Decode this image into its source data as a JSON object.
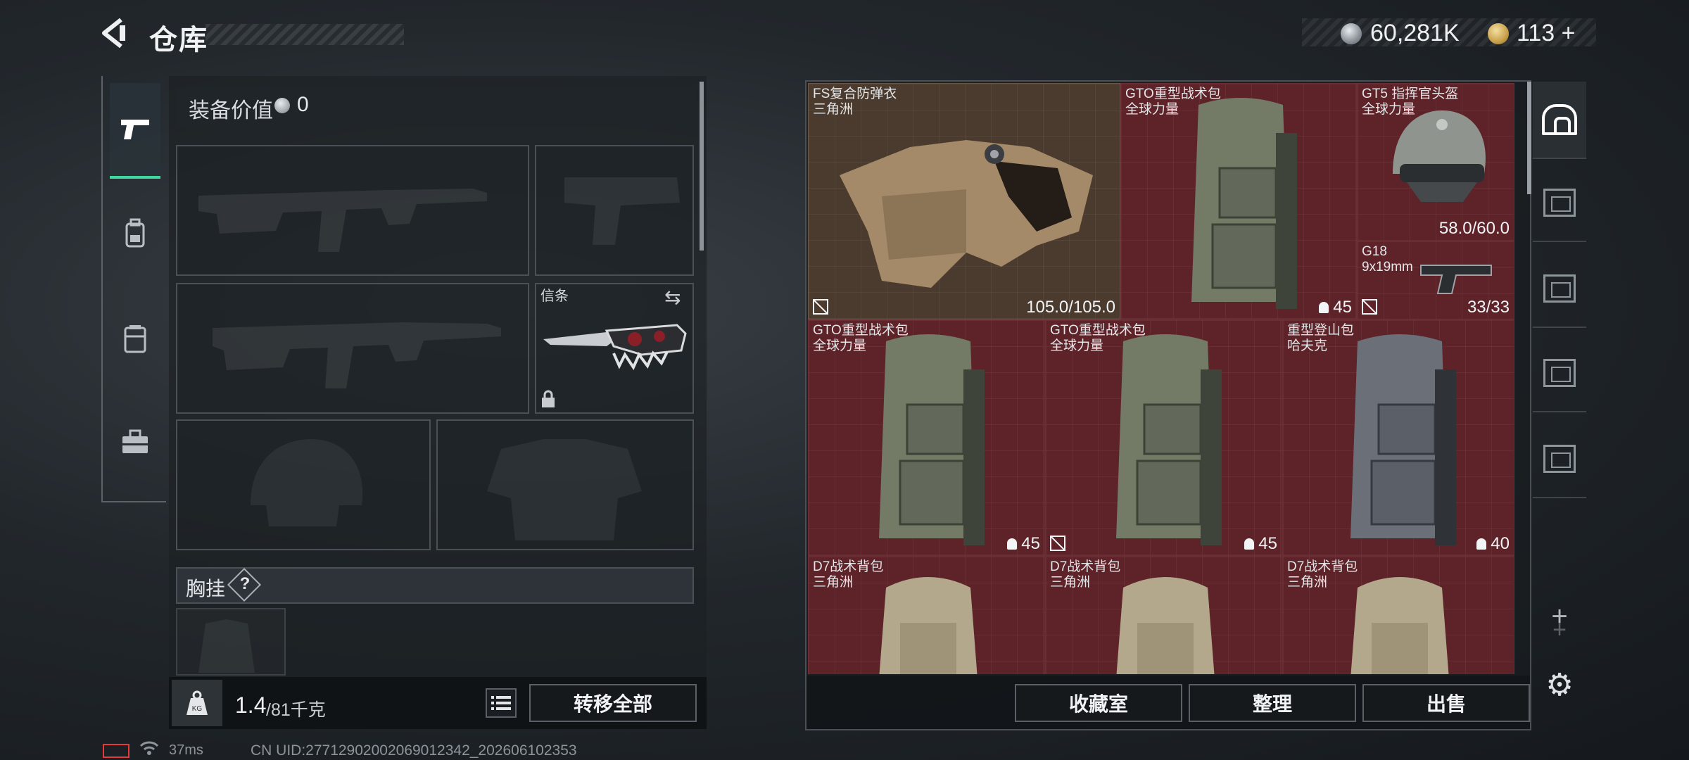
{
  "header": {
    "title": "仓库",
    "currency": {
      "coins": "60,281K",
      "gold": "113",
      "gold_add": "+"
    }
  },
  "left_tabs": [
    {
      "name": "weapons",
      "icon": "pistol-icon",
      "active": true
    },
    {
      "name": "gear",
      "icon": "backpack-icon"
    },
    {
      "name": "vest",
      "icon": "vest-icon"
    },
    {
      "name": "cases",
      "icon": "briefcase-icon"
    }
  ],
  "loadout": {
    "equip_value_label": "装备价值",
    "equip_value": "0",
    "melee_label": "信条",
    "chest_label": "胸挂",
    "chest_help": "?",
    "weight_current": "1.4",
    "weight_max": "/81千克",
    "transfer_all": "转移全部"
  },
  "stash_items": [
    {
      "name": "FS复合防弹衣",
      "maker": "三角洲",
      "value": "105.0/105.0",
      "color": "tan"
    },
    {
      "name": "GTO重型战术包",
      "maker": "全球力量",
      "capacity": "45",
      "color": "red"
    },
    {
      "name": "GT5 指挥官头盔",
      "maker": "全球力量",
      "value": "58.0/60.0",
      "color": "red"
    },
    {
      "name": "G18",
      "maker": "9x19mm",
      "value": "33/33",
      "color": "red"
    },
    {
      "name": "GTO重型战术包",
      "maker": "全球力量",
      "capacity": "45",
      "color": "red"
    },
    {
      "name": "GTO重型战术包",
      "maker": "全球力量",
      "capacity": "45",
      "color": "red"
    },
    {
      "name": "重型登山包",
      "maker": "哈夫克",
      "capacity": "40",
      "color": "red"
    },
    {
      "name": "D7战术背包",
      "maker": "三角洲",
      "color": "red"
    },
    {
      "name": "D7战术背包",
      "maker": "三角洲",
      "color": "red"
    },
    {
      "name": "D7战术背包",
      "maker": "三角洲",
      "color": "red"
    }
  ],
  "stash_buttons": {
    "collection": "收藏室",
    "sort": "整理",
    "sell": "出售"
  },
  "side_tabs": {
    "add": "+"
  },
  "status": {
    "ping": "37ms",
    "uid": "CN UID:27712902002069012342_202606102353"
  },
  "colors": {
    "accent": "#3fd8a0",
    "item_red": "#5e2229",
    "item_tan": "#4b3b2e"
  }
}
